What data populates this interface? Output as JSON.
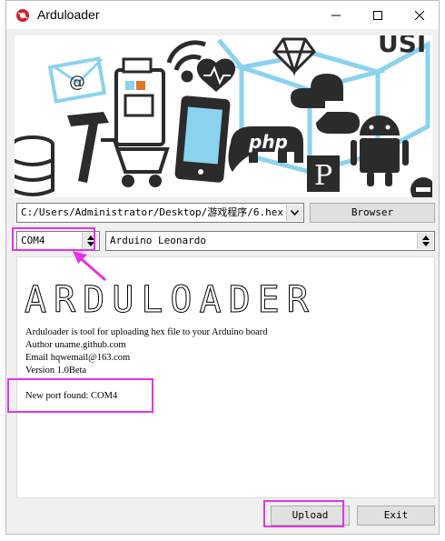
{
  "window": {
    "title": "Arduloader"
  },
  "toolbar": {
    "file_path": "C:/Users/Administrator/Desktop/游戏程序/6.hex",
    "browse_label": "Browser",
    "port_value": "COM4",
    "board_value": "Arduino Leonardo"
  },
  "hero": {
    "php_text": "php",
    "usb_text": "USI",
    "p_text": "P",
    "at_text": "@"
  },
  "console": {
    "banner": "ARDULOADER",
    "lines": [
      "Arduloader is tool for uploading hex file to your Arduino board",
      "Author uname.github.com",
      "Email hqwemail@163.com",
      "Version 1.0Beta"
    ],
    "status": "New port found: COM4"
  },
  "buttons": {
    "upload": "Upload",
    "exit": "Exit"
  },
  "colors": {
    "highlight": "#e234ea",
    "hero_blue": "#8ad3ef",
    "dark": "#2b2b2b"
  }
}
